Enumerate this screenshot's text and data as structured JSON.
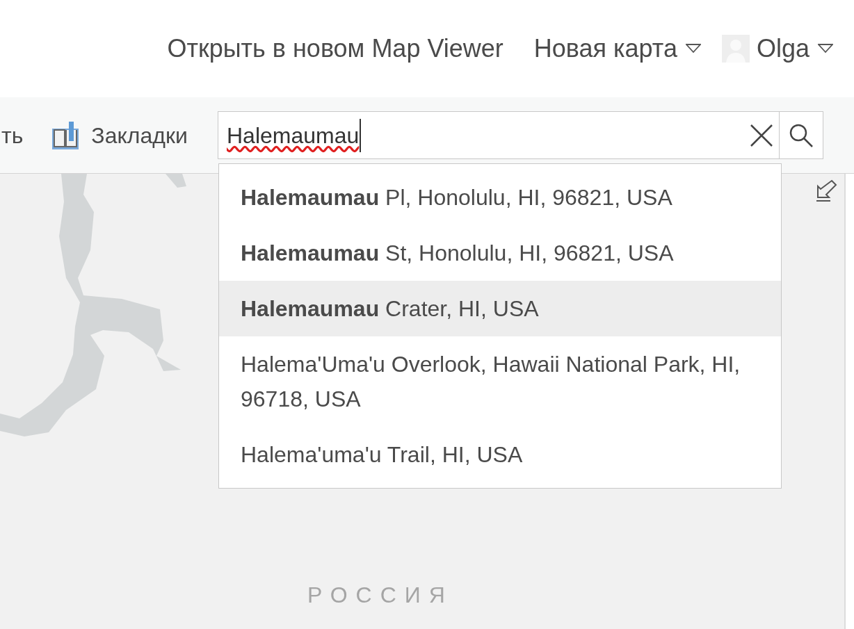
{
  "header": {
    "links": [
      {
        "label": "Открыть в новом Map Viewer",
        "dropdown": false
      },
      {
        "label": "Новая карта",
        "dropdown": true
      }
    ],
    "user": {
      "name": "Olga"
    }
  },
  "toolbar": {
    "cut_item": "ть",
    "bookmarks": "Закладки"
  },
  "search": {
    "value": "Halemaumau",
    "suggestions": [
      {
        "text": "**Halemaumau** Pl, Honolulu, HI, 96821, USA",
        "selected": false
      },
      {
        "text": "**Halemaumau** St, Honolulu, HI, 96821, USA",
        "selected": false
      },
      {
        "text": "**Halemaumau** Crater, HI, USA",
        "selected": true
      },
      {
        "text": "Halema'Uma'u Overlook, Hawaii National Park, HI, 96718, USA",
        "selected": false
      },
      {
        "text": "Halema'uma'u Trail, HI, USA",
        "selected": false
      }
    ]
  },
  "map": {
    "label": "РОССИЯ"
  }
}
